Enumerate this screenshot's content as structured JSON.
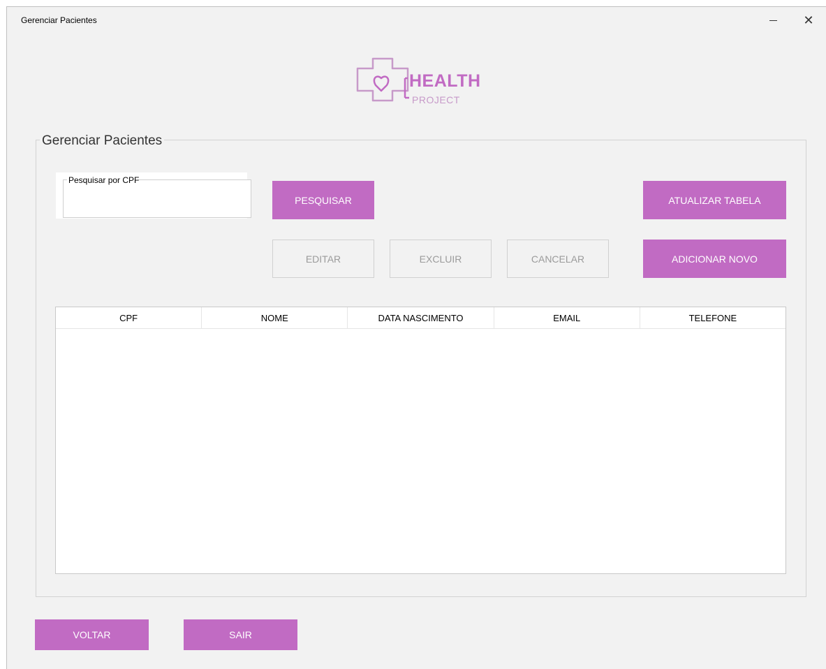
{
  "window": {
    "title": "Gerenciar Pacientes",
    "minimize_glyph": "—",
    "close_glyph": "✕"
  },
  "logo": {
    "word1": "HEALTH",
    "word2": "PROJECT"
  },
  "group": {
    "label": "Gerenciar Pacientes"
  },
  "search": {
    "legend": "Pesquisar por CPF",
    "value": "",
    "button_label": "PESQUISAR"
  },
  "actions": {
    "atualizar_label": "ATUALIZAR TABELA",
    "editar_label": "EDITAR",
    "excluir_label": "EXCLUIR",
    "cancelar_label": "CANCELAR",
    "adicionar_label": "ADICIONAR NOVO"
  },
  "table": {
    "columns": [
      "CPF",
      "NOME",
      "DATA NASCIMENTO",
      "EMAIL",
      "TELEFONE"
    ],
    "rows": []
  },
  "footer": {
    "voltar_label": "VOLTAR",
    "sair_label": "SAIR"
  },
  "colors": {
    "accent": "#c16bc3",
    "logo_secondary": "#c79ac9",
    "window_bg": "#f2f2f2",
    "disabled_text": "#9b9b9b"
  }
}
